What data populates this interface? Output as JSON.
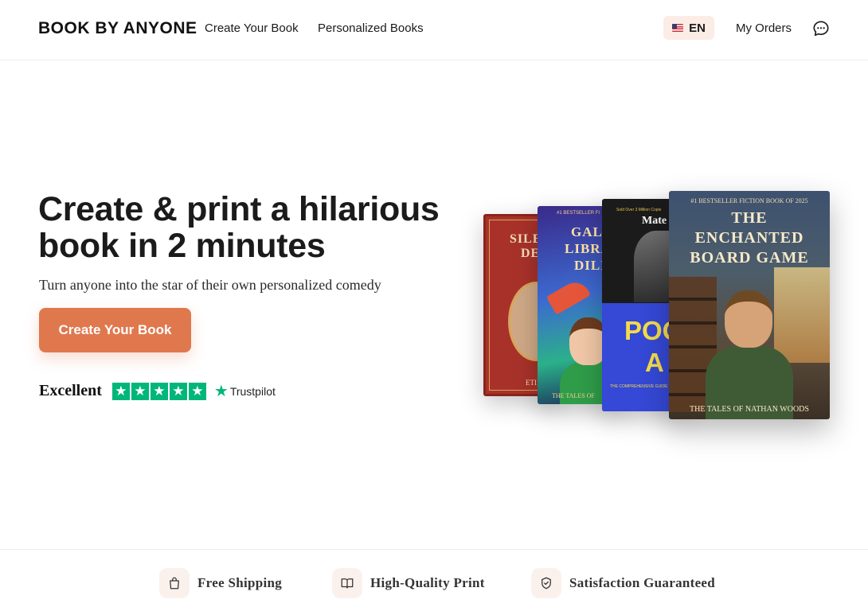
{
  "header": {
    "logo": "BOOK BY ANYONE",
    "nav": [
      "Create Your Book",
      "Personalized Books"
    ],
    "language": "EN",
    "my_orders": "My Orders",
    "chat_icon": "chat-bubble-icon"
  },
  "hero": {
    "title_line1": "Create & print a hilarious",
    "title_line2": "book in 2 minutes",
    "subtitle": "Turn anyone into the star of their own personalized comedy",
    "cta_label": "Create Your Book",
    "cta_color": "#e0784e",
    "rating_word": "Excellent",
    "rating_stars": 5,
    "trustpilot": "Trustpilot",
    "trustpilot_color": "#00b67a"
  },
  "books": {
    "book1": {
      "title_line1": "SILE",
      "title_line2": "DE",
      "author": "ETI"
    },
    "book2": {
      "header": "#1 BESTSELLER FI",
      "title_line1": "GAL",
      "title_line2": "LIBRA",
      "title_line3": "DILI",
      "footer": "THE TALES OF"
    },
    "book3": {
      "header": "Sold Over 3 Million Copie",
      "title": "Mate",
      "big_line1": "POO",
      "big_line2": "A",
      "subtext": "THE COMPREHENSIVE GUIDE TO"
    },
    "book4": {
      "header": "#1 BESTSELLER FICTION BOOK OF 2025",
      "title_line1": "THE",
      "title_line2": "ENCHANTED",
      "title_line3": "BOARD GAME",
      "footer": "THE TALES OF NATHAN WOODS"
    }
  },
  "features": [
    {
      "label": "Free Shipping",
      "icon": "shopping-bag-icon"
    },
    {
      "label": "High-Quality Print",
      "icon": "open-book-icon"
    },
    {
      "label": "Satisfaction Guaranteed",
      "icon": "shield-check-icon"
    }
  ]
}
